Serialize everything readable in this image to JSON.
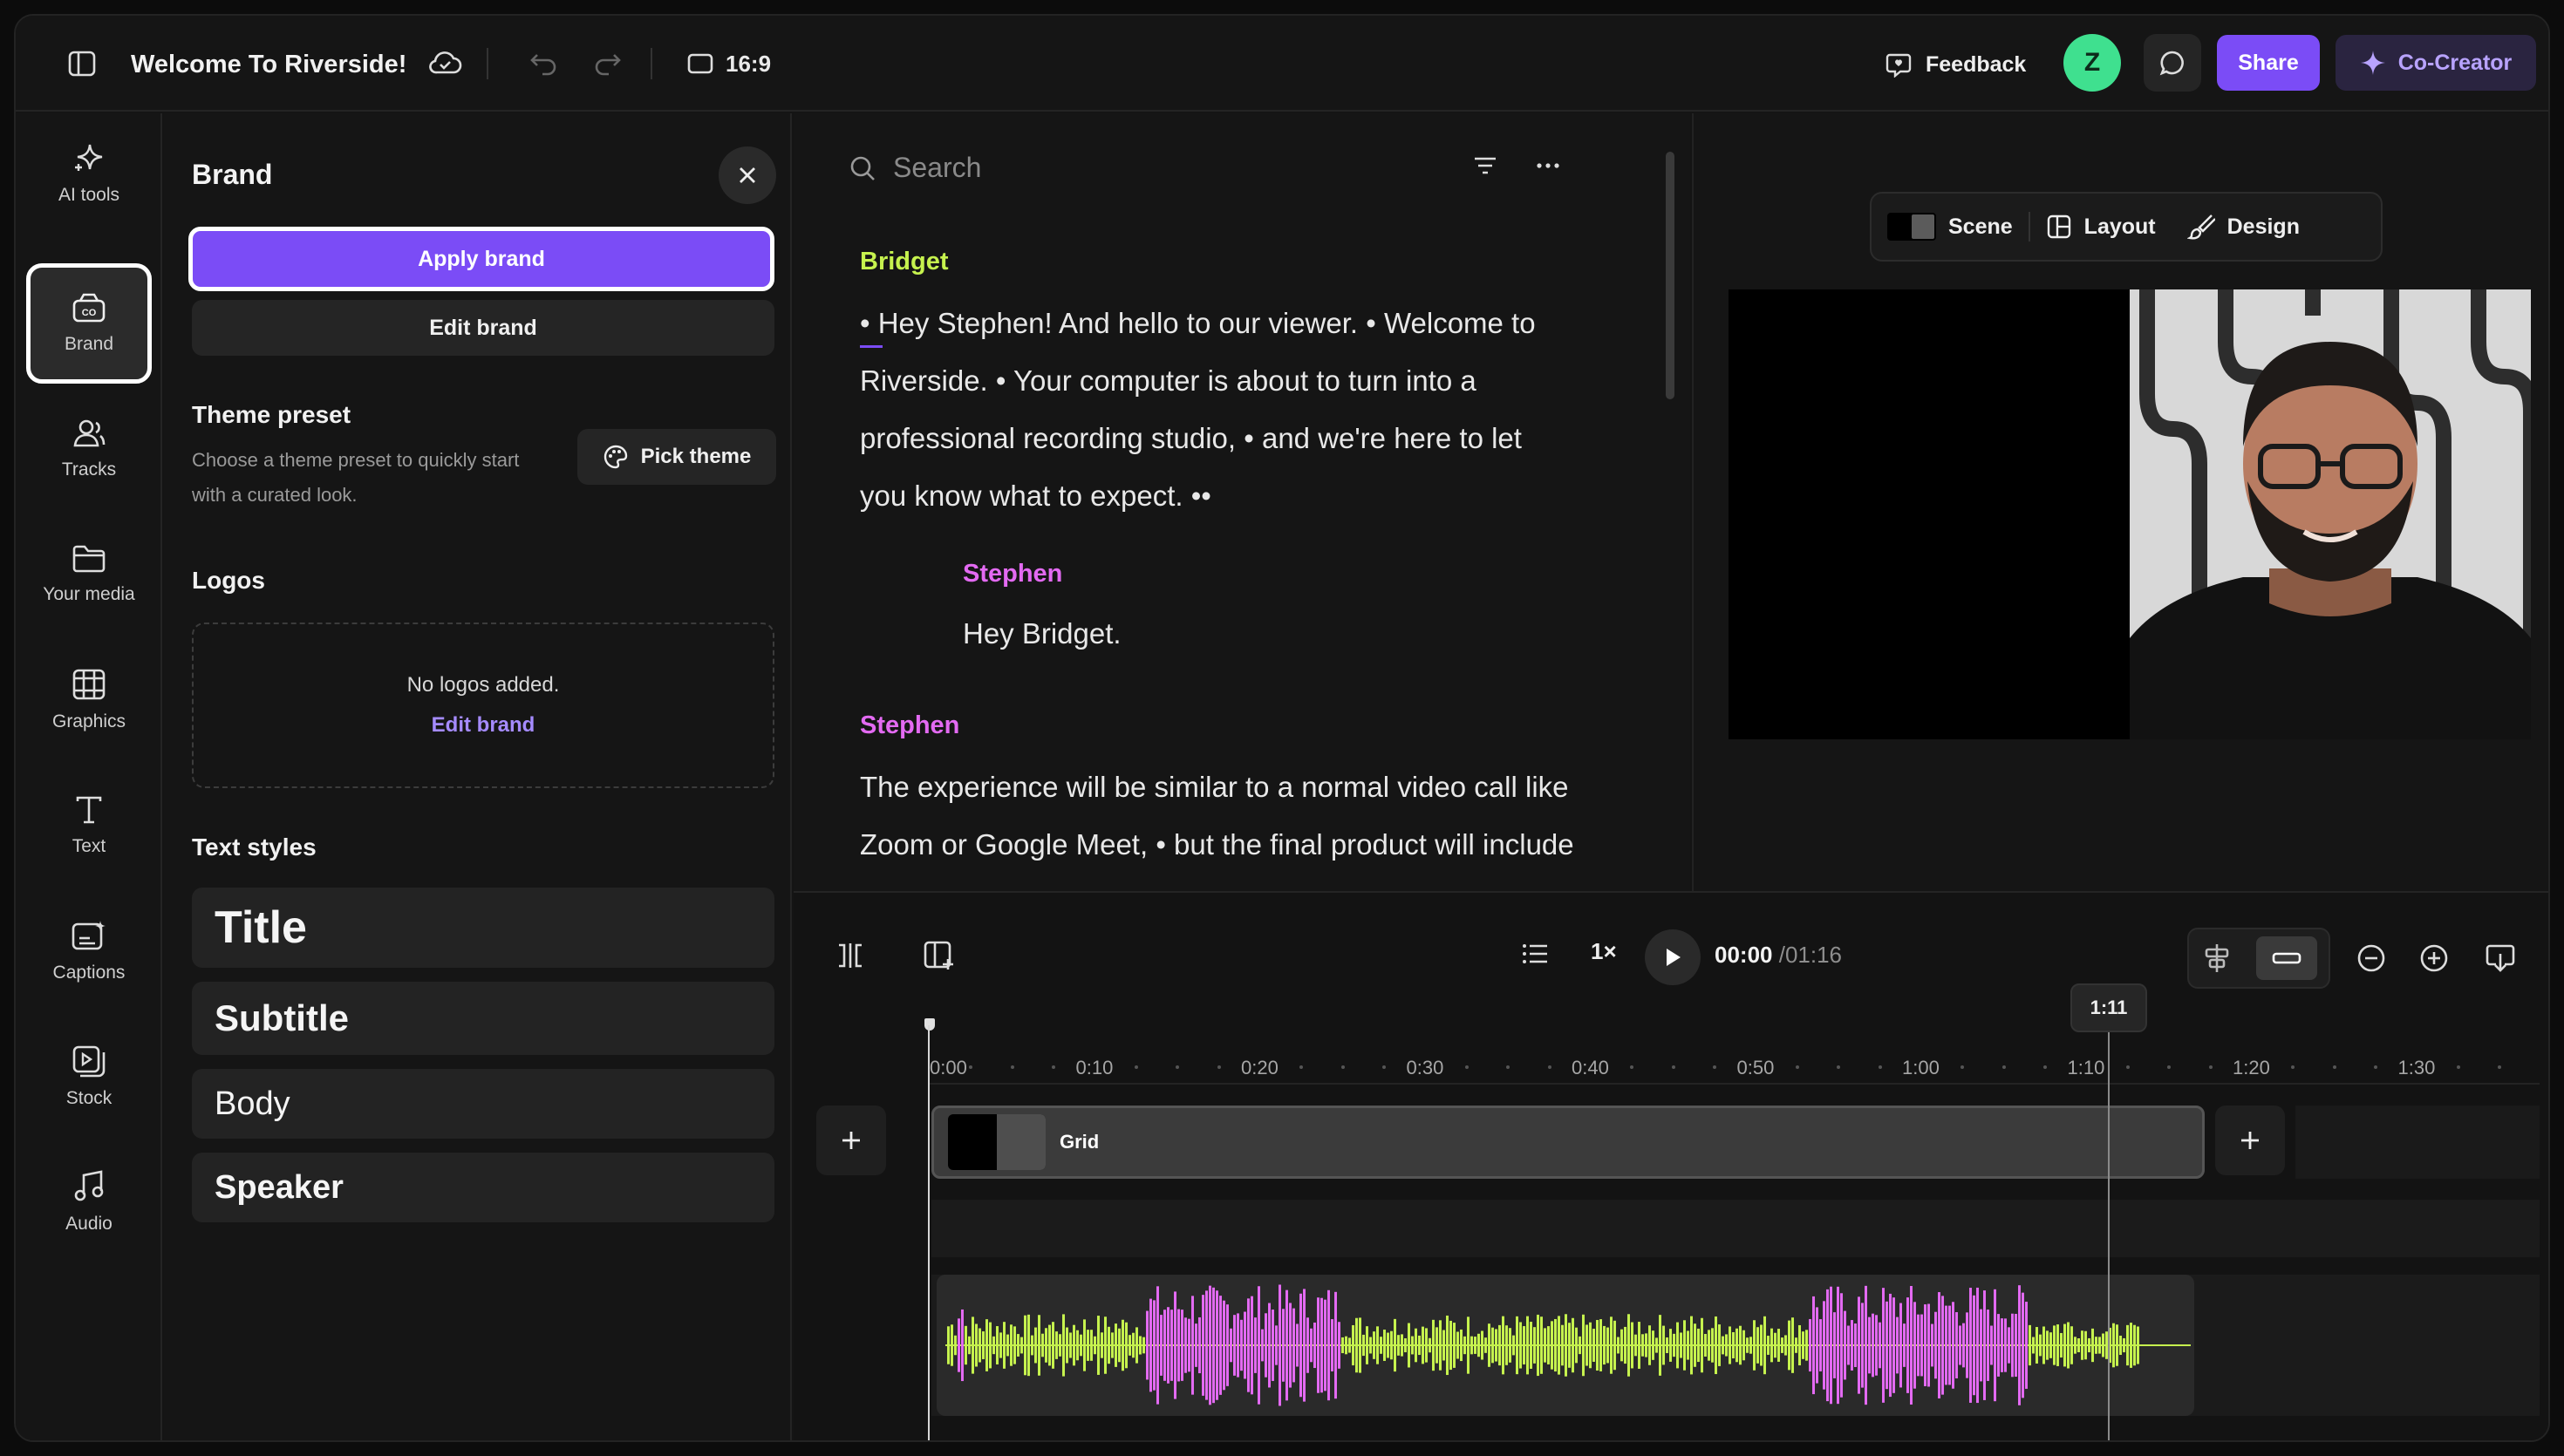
{
  "colors": {
    "accent": "#7b4cf6",
    "speaker_green": "#c6f24e",
    "speaker_pink": "#e36af2",
    "avatar_green": "#3fe08f",
    "link_purple": "#a58bff"
  },
  "topbar": {
    "title": "Welcome To Riverside!",
    "aspect_ratio": "16:9",
    "feedback_label": "Feedback",
    "avatar_initial": "Z",
    "share_label": "Share",
    "cocreator_label": "Co-Creator"
  },
  "rail": {
    "items": [
      {
        "label": "AI tools",
        "icon": "sparkle-icon"
      },
      {
        "label": "Brand",
        "icon": "brand-icon",
        "active": true
      },
      {
        "label": "Tracks",
        "icon": "users-icon"
      },
      {
        "label": "Your media",
        "icon": "folder-icon"
      },
      {
        "label": "Graphics",
        "icon": "graphics-icon"
      },
      {
        "label": "Text",
        "icon": "text-icon"
      },
      {
        "label": "Captions",
        "icon": "captions-icon"
      },
      {
        "label": "Stock",
        "icon": "stock-icon"
      },
      {
        "label": "Audio",
        "icon": "music-icon"
      }
    ]
  },
  "brand_panel": {
    "title": "Brand",
    "apply_label": "Apply brand",
    "edit_label": "Edit brand",
    "theme_title": "Theme preset",
    "theme_desc": "Choose a theme preset to quickly start with a curated look.",
    "pick_theme_label": "Pick theme",
    "logos_title": "Logos",
    "no_logos": "No logos added.",
    "logos_edit_link": "Edit brand",
    "text_styles_title": "Text styles",
    "styles": {
      "title": "Title",
      "subtitle": "Subtitle",
      "body": "Body",
      "speaker": "Speaker"
    }
  },
  "transcript": {
    "search_placeholder": "Search",
    "blocks": [
      {
        "speaker": "Bridget",
        "text": "• Hey Stephen! And hello to our viewer. • Welcome to Riverside. • Your computer is about to turn into a professional recording studio, • and we're here to let you know what to expect. ••"
      },
      {
        "speaker": "Stephen",
        "text": "Hey Bridget."
      },
      {
        "speaker": "Stephen",
        "text": "The experience will be similar to a normal video call like Zoom or Google Meet, • but the final product will include a pristine video and audio recording"
      }
    ]
  },
  "preview": {
    "scene_label": "Scene",
    "layout_label": "Layout",
    "design_label": "Design"
  },
  "timeline": {
    "speed": "1×",
    "current_time": "00:00",
    "total_time": "/01:16",
    "playhead_label": "1:11",
    "playhead_seconds": 71,
    "ruler_labels": [
      "0:00",
      "0:10",
      "0:20",
      "0:30",
      "0:40",
      "0:50",
      "1:00",
      "1:10",
      "1:20",
      "1:30"
    ],
    "clip_label": "Grid"
  }
}
